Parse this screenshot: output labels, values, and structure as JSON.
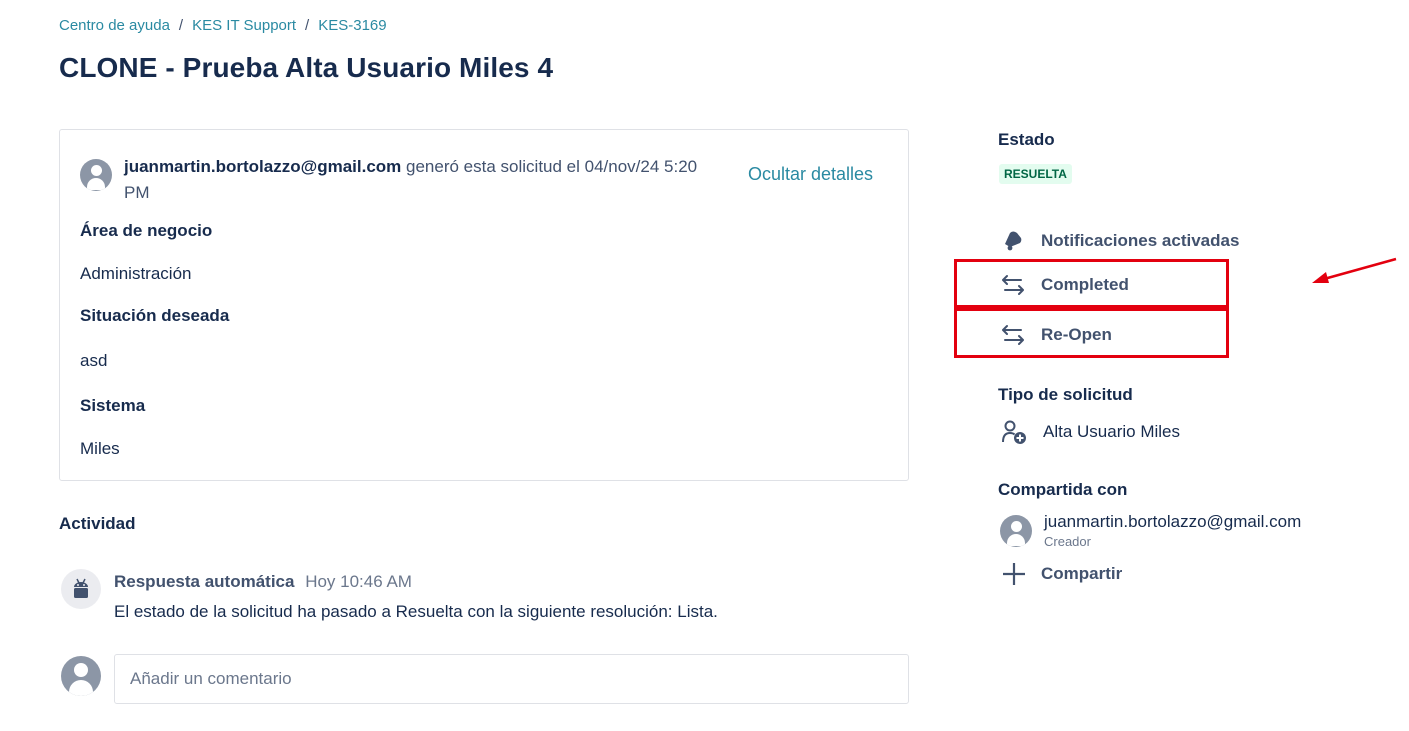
{
  "breadcrumb": {
    "items": [
      "Centro de ayuda",
      "KES IT Support",
      "KES-3169"
    ],
    "separator": "/"
  },
  "title": "CLONE - Prueba Alta Usuario Miles 4",
  "request": {
    "creator_email": "juanmartin.bortolazzo@gmail.com",
    "created_text": "generó esta solicitud el 04/nov/24 5:20 PM",
    "hide_details_label": "Ocultar detalles",
    "fields": [
      {
        "label": "Área de negocio",
        "value": "Administración"
      },
      {
        "label": "Situación deseada",
        "value": "asd"
      },
      {
        "label": "Sistema",
        "value": "Miles"
      }
    ]
  },
  "activity": {
    "heading": "Actividad",
    "entries": [
      {
        "author": "Respuesta automática",
        "time": "Hoy 10:46 AM",
        "message": "El estado de la solicitud ha pasado a Resuelta con la siguiente resolución: Lista."
      }
    ],
    "comment_placeholder": "Añadir un comentario"
  },
  "sidebar": {
    "status_label": "Estado",
    "status_value": "RESUELTA",
    "notifications_label": "Notificaciones activadas",
    "transitions": [
      {
        "label": "Completed"
      },
      {
        "label": "Re-Open"
      }
    ],
    "request_type_label": "Tipo de solicitud",
    "request_type_value": "Alta Usuario Miles",
    "shared_label": "Compartida con",
    "shared_user": {
      "email": "juanmartin.bortolazzo@gmail.com",
      "role": "Creador"
    },
    "share_label": "Compartir"
  },
  "colors": {
    "link": "#2a8aa2",
    "text": "#172b4d",
    "muted": "#42526e",
    "status_bg": "#e3fcef",
    "status_text": "#006644",
    "annotation": "#e3000f"
  },
  "icons": [
    "bell-icon",
    "transition-icon",
    "user-add-icon",
    "plus-icon",
    "robot-icon",
    "user-avatar-icon"
  ]
}
